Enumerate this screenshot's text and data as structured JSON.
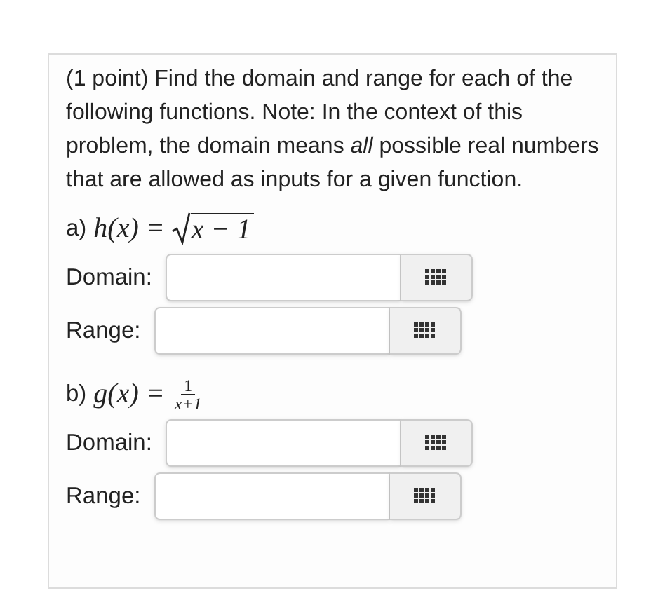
{
  "question": {
    "points": "(1 point)",
    "text": "Find the domain and range for each of the following functions. Note: In the context of this problem, the domain means *all* possible real numbers that are allowed as inputs for a given function."
  },
  "parts": [
    {
      "label": "a)",
      "function": "h(x) =",
      "kind": "sqrt",
      "radicand": "x − 1",
      "fields": [
        {
          "label": "Domain:"
        },
        {
          "label": "Range:"
        }
      ]
    },
    {
      "label": "b)",
      "function": "g(x) =",
      "kind": "fraction",
      "numerator": "1",
      "denominator": "x+1",
      "fields": [
        {
          "label": "Domain:"
        },
        {
          "label": "Range:"
        }
      ]
    }
  ]
}
